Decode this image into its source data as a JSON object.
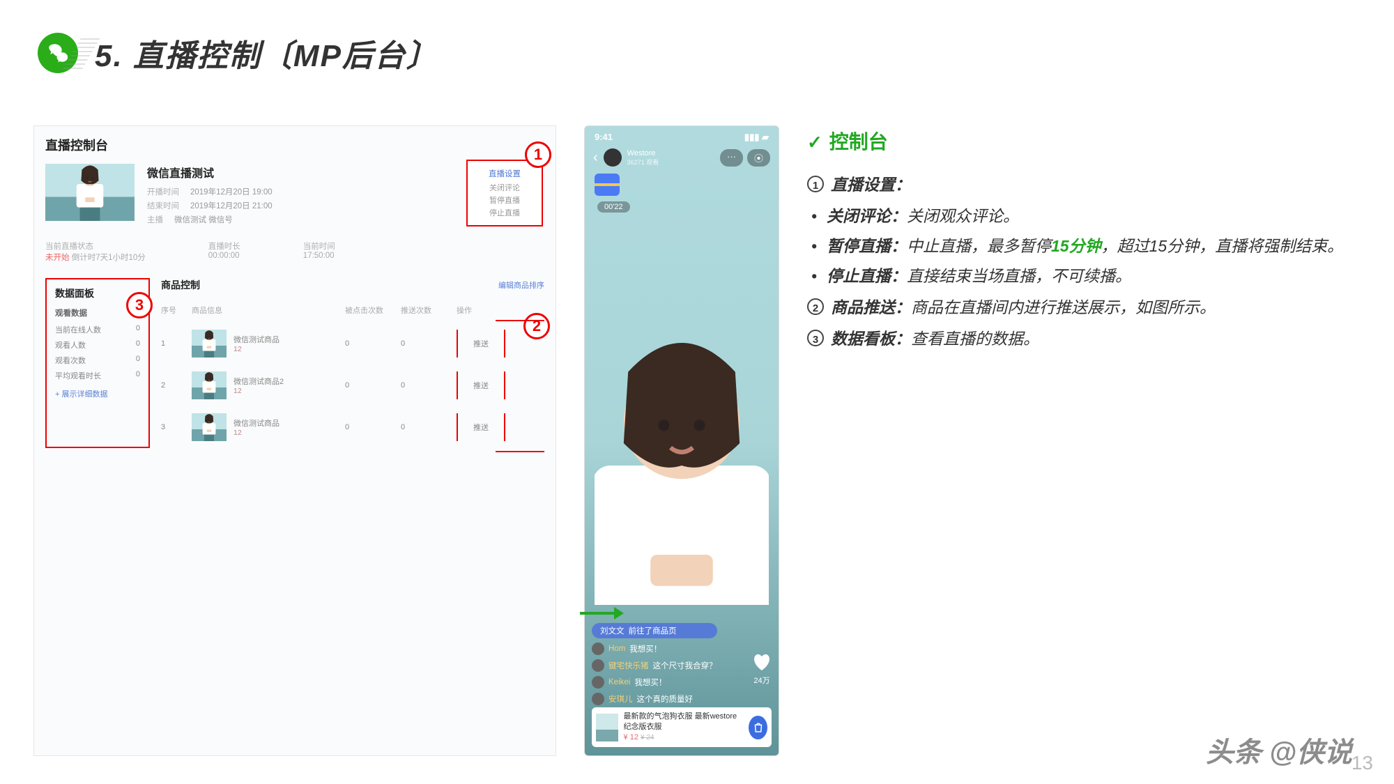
{
  "slide": {
    "title": "5. 直播控制〔MP后台〕"
  },
  "console": {
    "title": "直播控制台",
    "live_title": "微信直播测试",
    "plan_label": "开播时间",
    "plan_value": "2019年12月20日 19:00",
    "end_label": "结束时间",
    "end_value": "2019年12月20日 21:00",
    "host_label": "主播",
    "host_value": "微信测试   微信号",
    "settings_hdr": "直播设置",
    "settings_a": "关闭评论",
    "settings_b": "暂停直播",
    "settings_c": "停止直播",
    "status_lbl": "当前直播状态",
    "status_val": "未开始",
    "status_extra": "倒计时7天1小时10分",
    "dur_lbl": "直播时长",
    "dur_val": "00:00:00",
    "cur_lbl": "当前时间",
    "cur_val": "17:50:00",
    "databoard_title": "数据面板",
    "databoard_sub": "观看数据",
    "d1": "当前在线人数",
    "d2": "观看人数",
    "d3": "观看次数",
    "d4": "平均观看时长",
    "zero": "0",
    "more": "+ 展示详细数据",
    "goods_title": "商品控制",
    "goods_edit": "编辑商品排序",
    "th_idx": "序号",
    "th_info": "商品信息",
    "th_click": "被点击次数",
    "th_push": "推送次数",
    "th_op": "操作",
    "g1": "微信测试商品",
    "g2": "微信测试商品2",
    "g3": "微信测试商品",
    "gprice": "12",
    "push": "推送"
  },
  "badges": {
    "one": "1",
    "two": "2",
    "three": "3"
  },
  "phone": {
    "time": "9:41",
    "store": "Westore",
    "store_sub": "36271 观看",
    "pill_more": "···",
    "pill_close": "⦿",
    "timer": "00'22",
    "like_count": "24万",
    "banner_name": "刘文文",
    "banner_text": "前往了商品页",
    "c1_name": "Hom",
    "c1_text": "我想买！",
    "c2_name": "键宅快乐猪",
    "c2_text": "这个尺寸我合穿？",
    "c3_name": "Keikei",
    "c3_text": "我想买！",
    "c4_name": "安琪儿",
    "c4_text": "这个真的质量好",
    "product_title": "最新款的气泡狗衣服 最新westore纪念版衣服",
    "product_price": "¥ 12",
    "product_strike": "¥ 24"
  },
  "notes": {
    "h": "控制台",
    "n1_title": "直播设置：",
    "n1a_bold": "关闭评论：",
    "n1a": "关闭观众评论。",
    "n1b_bold": "暂停直播：",
    "n1b_1": "中止直播，最多暂停",
    "n1b_green": "15分钟",
    "n1b_2": "，超过15分钟，直播将强制结束。",
    "n1c_bold": "停止直播：",
    "n1c": "直接结束当场直播，不可续播。",
    "n2_title": "商品推送：",
    "n2": "商品在直播间内进行推送展示，如图所示。",
    "n3_title": "数据看板：",
    "n3": "查看直播的数据。"
  },
  "watermark": "头条 @侠说",
  "page_num": "13"
}
